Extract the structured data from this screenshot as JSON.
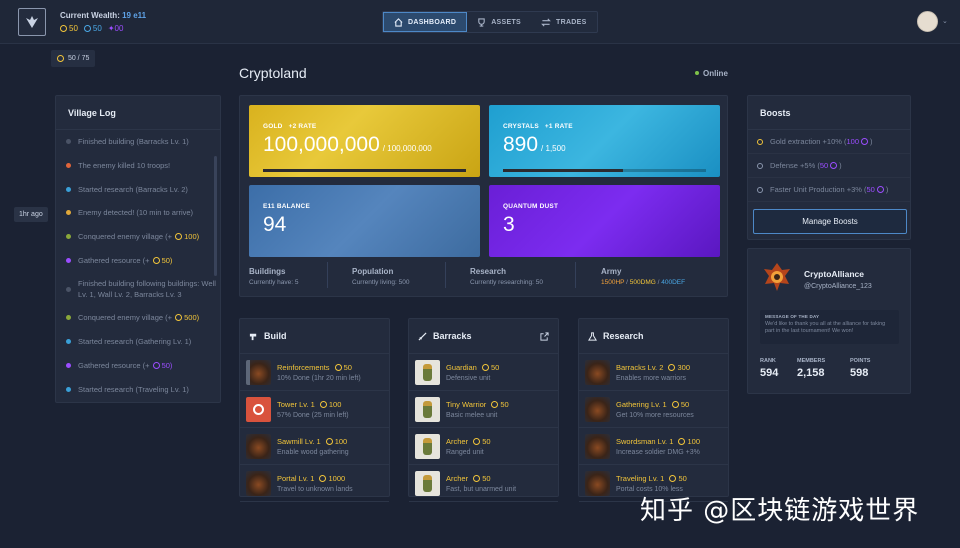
{
  "header": {
    "wealth_label": "Current Wealth:",
    "wealth_value": "19 e11",
    "gold": "50",
    "crystals": "50",
    "quantum": "00",
    "cap_badge": "50 / 75",
    "nav": [
      {
        "label": "DASHBOARD",
        "icon": "home-icon",
        "active": true
      },
      {
        "label": "ASSETS",
        "icon": "trophy-icon",
        "active": false
      },
      {
        "label": "TRADES",
        "icon": "swap-icon",
        "active": false
      }
    ]
  },
  "page": {
    "title": "Cryptoland",
    "status": "Online"
  },
  "village_log": {
    "title": "Village Log",
    "tooltip": "1hr ago",
    "items": [
      {
        "text": "Finished building (Barracks Lv. 1)",
        "color": "#4a5366"
      },
      {
        "text": "The enemy killed 10 troops!",
        "color": "#e0643a"
      },
      {
        "text": "Started research (Barracks Lv. 2)",
        "color": "#3aa0d8"
      },
      {
        "text": "Enemy detected! (10 min to arrive)",
        "color": "#e0a83a"
      },
      {
        "text": "Conquered enemy village (+ ",
        "suffix": "100)",
        "color": "#8aa83a",
        "coin": "gold"
      },
      {
        "text": "Gathered resource (+ ",
        "suffix": "50)",
        "color": "#9b4dff",
        "coin": "gold"
      },
      {
        "text": "Finished building following buildings: Well Lv. 1, Wall Lv. 2, Barracks Lv. 3",
        "color": "#4a5366",
        "tall": true
      },
      {
        "text": "Conquered enemy village (+ ",
        "suffix": "500)",
        "color": "#8aa83a",
        "coin": "gold"
      },
      {
        "text": "Started research (Gathering Lv. 1)",
        "color": "#3aa0d8"
      },
      {
        "text": "Gathered resource (+ ",
        "suffix": "50)",
        "color": "#9b4dff",
        "coin": "purple"
      },
      {
        "text": "Started research (Traveling Lv. 1)",
        "color": "#3aa0d8"
      }
    ]
  },
  "cards": {
    "gold": {
      "label": "GOLD",
      "rate": "+2 RATE",
      "value": "100,000,000",
      "max": "/ 100,000,000",
      "progress": 1.0
    },
    "crystals": {
      "label": "CRYSTALS",
      "rate": "+1 RATE",
      "value": "890",
      "max": "/ 1,500",
      "progress": 0.59
    },
    "e11": {
      "label": "E11 BALANCE",
      "value": "94"
    },
    "quantum": {
      "label": "QUANTUM DUST",
      "value": "3"
    }
  },
  "summary": {
    "buildings": {
      "label": "Buildings",
      "sub": "Currently have: 5"
    },
    "population": {
      "label": "Population",
      "sub": "Currently living: 500"
    },
    "research": {
      "label": "Research",
      "sub": "Currently researching: 50"
    },
    "army": {
      "label": "Army",
      "hp": "1500HP",
      "dmg": "500DMG",
      "def": "400DEF"
    }
  },
  "boosts": {
    "title": "Boosts",
    "items": [
      {
        "text": "Gold extraction +10% (",
        "val": "100",
        "active": true
      },
      {
        "text": "Defense +5% (",
        "val": "50",
        "active": false
      },
      {
        "text": "Faster Unit Production +3% (",
        "val": "50",
        "active": false
      }
    ],
    "button": "Manage Boosts"
  },
  "alliance": {
    "name": "CryptoAlliance",
    "handle": "@CryptoAlliance_123",
    "motd_title": "MESSAGE OF THE DAY",
    "motd_body": "We'd like to thank you all at the alliance for taking part in the last tournament! We won!",
    "rank_label": "RANK",
    "rank": "594",
    "members_label": "MEMBERS",
    "members": "2,158",
    "points_label": "POINTS",
    "points": "598"
  },
  "build": {
    "title": "Build",
    "items": [
      {
        "name": "Reinforcements",
        "cost": "50",
        "sub": "10% Done (1hr 20 min left)",
        "thumb": "sidebar"
      },
      {
        "name": "Tower Lv. 1",
        "cost": "100",
        "sub": "57% Done (25 min left)",
        "thumb": "red"
      },
      {
        "name": "Sawmill Lv. 1",
        "cost": "100",
        "sub": "Enable wood gathering",
        "thumb": "dark"
      },
      {
        "name": "Portal Lv. 1",
        "cost": "1000",
        "sub": "Travel to unknown lands",
        "thumb": "dark"
      }
    ]
  },
  "barracks": {
    "title": "Barracks",
    "items": [
      {
        "name": "Guardian",
        "cost": "50",
        "sub": "Defensive unit"
      },
      {
        "name": "Tiny Warrior",
        "cost": "50",
        "sub": "Basic melee unit"
      },
      {
        "name": "Archer",
        "cost": "50",
        "sub": "Ranged unit"
      },
      {
        "name": "Archer",
        "cost": "50",
        "sub": "Fast, but unarmed unit"
      }
    ]
  },
  "research": {
    "title": "Research",
    "items": [
      {
        "name": "Barracks Lv. 2",
        "cost": "300",
        "sub": "Enables more warriors"
      },
      {
        "name": "Gathering Lv. 1",
        "cost": "50",
        "sub": "Get 10% more resources"
      },
      {
        "name": "Swordsman Lv. 1",
        "cost": "100",
        "sub": "Increase soldier DMG +3%"
      },
      {
        "name": "Traveling Lv. 1",
        "cost": "50",
        "sub": "Portal costs 10% less"
      }
    ]
  },
  "watermark": "知乎 @区块链游戏世界"
}
